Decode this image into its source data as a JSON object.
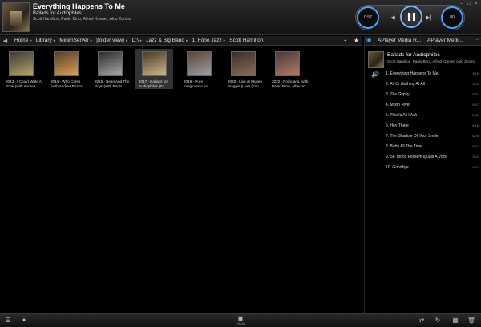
{
  "now_playing": {
    "title": "Everything Happens To Me",
    "album": "Ballads for Audiophiles",
    "artists": "Scott Hamilton, Paolo Birro, Alfred Kramer, Aldo Zunino",
    "elapsed": "0:57",
    "volume": "80"
  },
  "breadcrumb": {
    "items": [
      "Home",
      "Library",
      "MinimServer",
      "[folder view]",
      "D:\\",
      "Jazz & Big Band",
      "1. Foné Jazz",
      "Scott Hamilton"
    ],
    "more": "◂",
    "pin": "★"
  },
  "albums": [
    {
      "label": "2013 - I Could Write A Book (with Andrea...",
      "c1": "#3b3a32",
      "c2": "#b8a56a"
    },
    {
      "label": "2014 - Who Cares (with Andrea Pozza) (Foné...",
      "c1": "#5a3d22",
      "c2": "#d6a35a"
    },
    {
      "label": "2015 - Bean And The Boys (with Paolo Birro)...",
      "c1": "#2b2b2b",
      "c2": "#a8a8a8"
    },
    {
      "label": "2017 - Ballads for Audiophiles (Fo...",
      "c1": "#4a3b22",
      "c2": "#c9b892"
    },
    {
      "label": "2019 - Pure Imagination (wi...",
      "c1": "#5a4536",
      "c2": "#9ca0a6"
    },
    {
      "label": "2020 - Live at Museo Piaggio (Live) (Fon...",
      "c1": "#3a2e28",
      "c2": "#8a6d5a"
    },
    {
      "label": "2022 - Poinciana (with Paolo Birro, Alfred K...",
      "c1": "#4a3a3a",
      "c2": "#b07a6a"
    }
  ],
  "right_panel": {
    "tab1": "APlayer Media R...",
    "tab2": "APlayer Medi...",
    "close": "→",
    "album_title": "Ballads for Audiophiles",
    "album_artists": "Scott Hamilton, Paolo Birro, Alfred Kramer, Aldo Zunino",
    "tracks": [
      {
        "name": "1. Everything Happens To Me",
        "dur": "3:15"
      },
      {
        "name": "2. All Or Nothing At All",
        "dur": "3:02"
      },
      {
        "name": "3. The Gypsy",
        "dur": "5:31"
      },
      {
        "name": "4. Moon River",
        "dur": "4:47"
      },
      {
        "name": "5. This Is All I Ask",
        "dur": "5:01"
      },
      {
        "name": "6. Hey There",
        "dur": "5:18"
      },
      {
        "name": "7. The Shadow Of Your Smile",
        "dur": "6:26"
      },
      {
        "name": "8. Baby All The Time",
        "dur": "4:51"
      },
      {
        "name": "9. Se Todos Fossem Iguais A Você",
        "dur": "5:11"
      },
      {
        "name": "10. Goodbye",
        "dur": "5:42"
      }
    ]
  },
  "bottom": {
    "center_label": "LOCAL",
    "icons": [
      "list-icon",
      "wrench-icon",
      "device-icon",
      "shuffle-icon",
      "repeat-icon",
      "save-icon",
      "trash-icon"
    ]
  }
}
